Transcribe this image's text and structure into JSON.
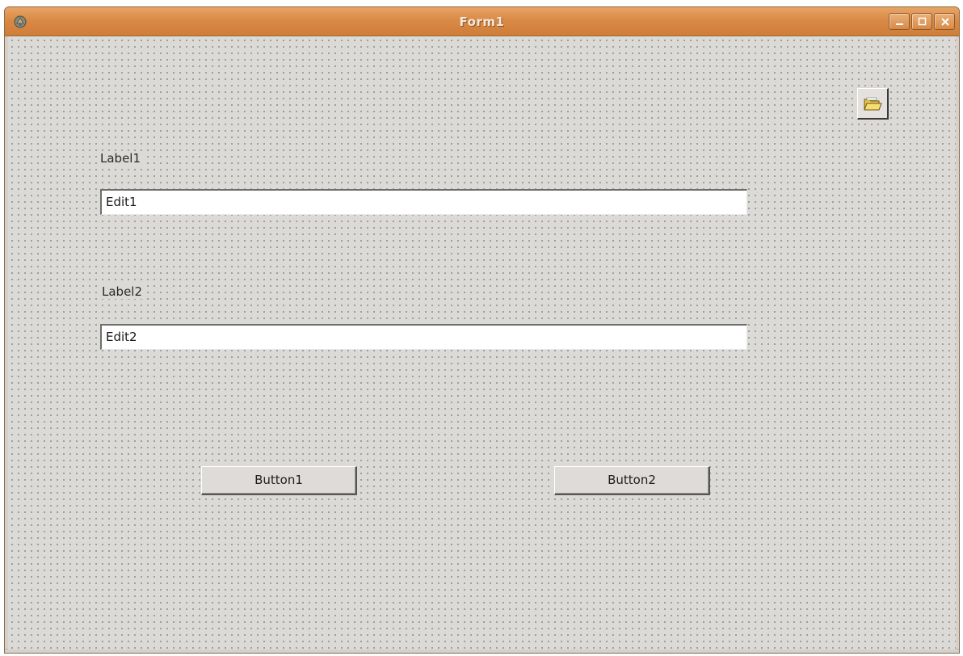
{
  "window": {
    "title": "Form1",
    "controls": [
      "minimize",
      "maximize",
      "close"
    ]
  },
  "components": {
    "open_dialog_icon": "folder-open-icon"
  },
  "fields": {
    "label1": "Label1",
    "edit1": "Edit1",
    "label2": "Label2",
    "edit2": "Edit2"
  },
  "buttons": {
    "button1": "Button1",
    "button2": "Button2"
  },
  "colors": {
    "titlebar": "#d98a45",
    "form_background": "#dcdad7",
    "grid_dots": "#8a8a8a"
  }
}
